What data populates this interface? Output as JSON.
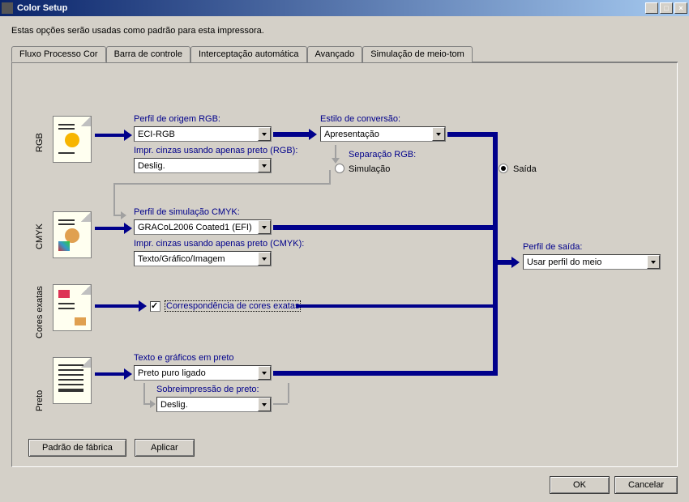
{
  "titlebar": {
    "title": "Color Setup"
  },
  "description": "Estas opções serão usadas como padrão para esta impressora.",
  "tabs": [
    {
      "label": "Fluxo Processo Cor"
    },
    {
      "label": "Barra de controle"
    },
    {
      "label": "Interceptação automática"
    },
    {
      "label": "Avançado"
    },
    {
      "label": "Simulação de meio-tom"
    }
  ],
  "rows": {
    "rgb": "RGB",
    "cmyk": "CMYK",
    "spot": "Cores exatas",
    "black": "Preto"
  },
  "rgb": {
    "source_label": "Perfil de origem RGB:",
    "source_value": "ECI-RGB",
    "gray_label": "Impr. cinzas usando apenas preto (RGB):",
    "gray_value": "Deslig.",
    "rendering_label": "Estilo de conversão:",
    "rendering_value": "Apresentação",
    "sep_label": "Separação RGB:",
    "sim_radio": "Simulação",
    "out_radio": "Saída"
  },
  "cmyk": {
    "sim_label": "Perfil de simulação CMYK:",
    "sim_value": "GRACoL2006 Coated1 (EFI)",
    "gray_label": "Impr. cinzas usando apenas preto (CMYK):",
    "gray_value": "Texto/Gráfico/Imagem"
  },
  "spot": {
    "match_label": "Correspondência de cores exatas"
  },
  "black": {
    "text_label": "Texto e gráficos em preto",
    "text_value": "Preto puro ligado",
    "over_label": "Sobreimpressão de preto:",
    "over_value": "Deslig."
  },
  "output": {
    "label": "Perfil de saída:",
    "value": "Usar perfil do meio"
  },
  "buttons": {
    "factory": "Padrão de fábrica",
    "apply": "Aplicar",
    "ok": "OK",
    "cancel": "Cancelar"
  }
}
